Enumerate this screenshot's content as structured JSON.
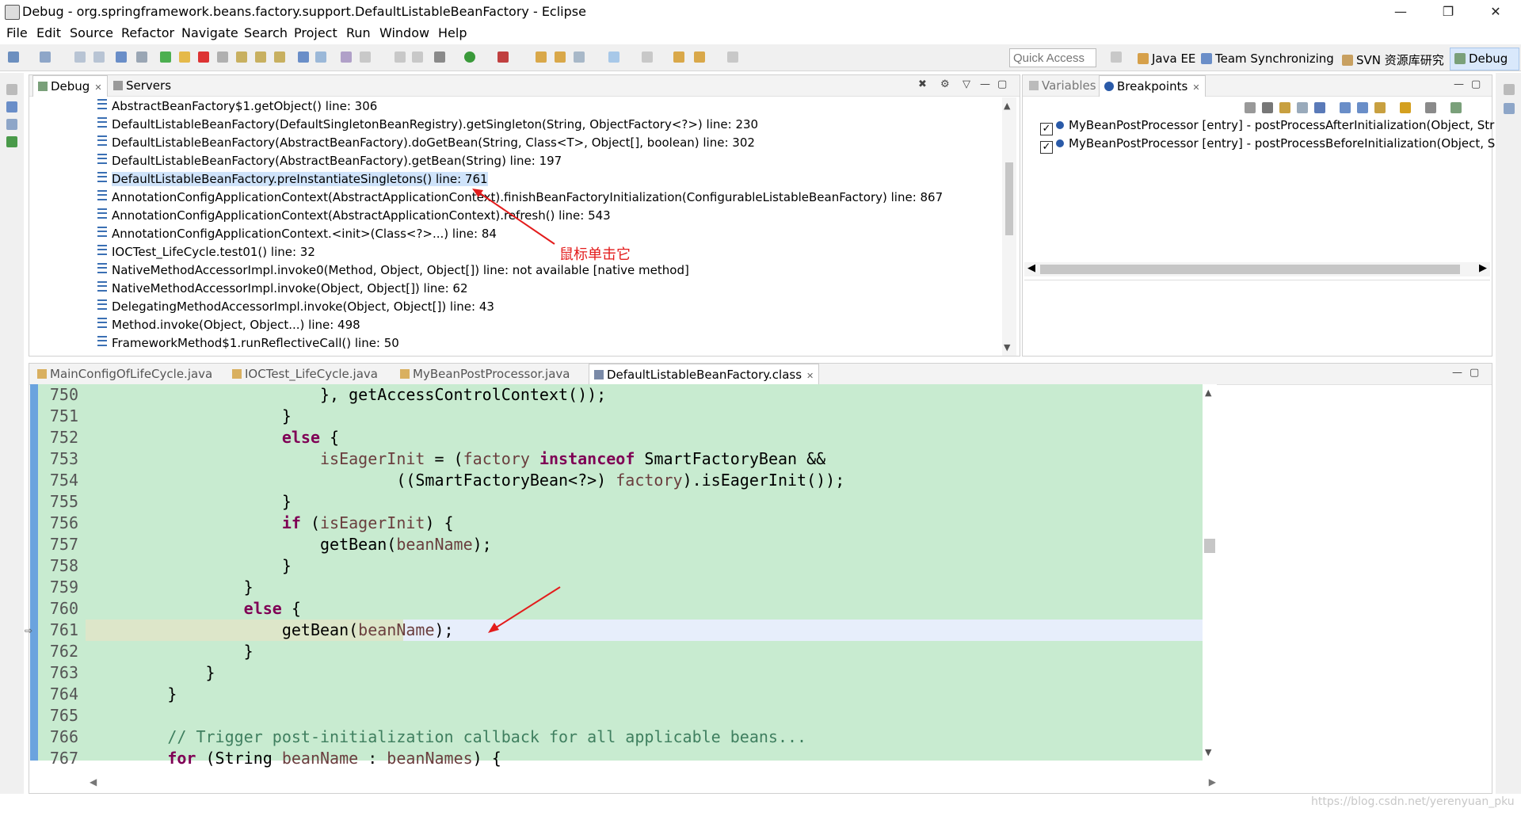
{
  "window": {
    "title": "Debug - org.springframework.beans.factory.support.DefaultListableBeanFactory - Eclipse",
    "controls": {
      "minimize": "—",
      "restore": "❐",
      "close": "✕"
    }
  },
  "menu": [
    "File",
    "Edit",
    "Source",
    "Refactor",
    "Navigate",
    "Search",
    "Project",
    "Run",
    "Window",
    "Help"
  ],
  "toolbar": {
    "quick_access_placeholder": "Quick Access",
    "perspectives": [
      "Java EE",
      "Team Synchronizing",
      "SVN 资源库研究",
      "Debug"
    ]
  },
  "debug_view": {
    "tabs": [
      "Debug",
      "Servers"
    ],
    "frames": [
      "AbstractBeanFactory$1.getObject() line: 306",
      "DefaultListableBeanFactory(DefaultSingletonBeanRegistry).getSingleton(String, ObjectFactory<?>) line: 230",
      "DefaultListableBeanFactory(AbstractBeanFactory).doGetBean(String, Class<T>, Object[], boolean) line: 302",
      "DefaultListableBeanFactory(AbstractBeanFactory).getBean(String) line: 197",
      "DefaultListableBeanFactory.preInstantiateSingletons() line: 761",
      "AnnotationConfigApplicationContext(AbstractApplicationContext).finishBeanFactoryInitialization(ConfigurableListableBeanFactory) line: 867",
      "AnnotationConfigApplicationContext(AbstractApplicationContext).refresh() line: 543",
      "AnnotationConfigApplicationContext.<init>(Class<?>...) line: 84",
      "IOCTest_LifeCycle.test01() line: 32",
      "NativeMethodAccessorImpl.invoke0(Method, Object, Object[]) line: not available [native method]",
      "NativeMethodAccessorImpl.invoke(Object, Object[]) line: 62",
      "DelegatingMethodAccessorImpl.invoke(Object, Object[]) line: 43",
      "Method.invoke(Object, Object...) line: 498",
      "FrameworkMethod$1.runReflectiveCall() line: 50"
    ],
    "annotation": "鼠标单击它"
  },
  "breakpoints_view": {
    "tabs": [
      "Variables",
      "Breakpoints"
    ],
    "items": [
      {
        "checked": "✓",
        "label": "MyBeanPostProcessor [entry] - postProcessAfterInitialization(Object, Str"
      },
      {
        "checked": "✓",
        "label": "MyBeanPostProcessor [entry] - postProcessBeforeInitialization(Object, S"
      }
    ]
  },
  "editor": {
    "tabs": [
      "MainConfigOfLifeCycle.java",
      "IOCTest_LifeCycle.java",
      "MyBeanPostProcessor.java",
      "DefaultListableBeanFactory.class"
    ],
    "lines": [
      {
        "num": "750",
        "code": "                        }, getAccessControlContext());"
      },
      {
        "num": "751",
        "code": "                    }"
      },
      {
        "num": "752",
        "code": "                    else {"
      },
      {
        "num": "753",
        "code": "                        isEagerInit = (factory instanceof SmartFactoryBean &&"
      },
      {
        "num": "754",
        "code": "                                ((SmartFactoryBean<?>) factory).isEagerInit());"
      },
      {
        "num": "755",
        "code": "                    }"
      },
      {
        "num": "756",
        "code": "                    if (isEagerInit) {"
      },
      {
        "num": "757",
        "code": "                        getBean(beanName);"
      },
      {
        "num": "758",
        "code": "                    }"
      },
      {
        "num": "759",
        "code": "                }"
      },
      {
        "num": "760",
        "code": "                else {"
      },
      {
        "num": "761",
        "code": "                    getBean(beanName);"
      },
      {
        "num": "762",
        "code": "                }"
      },
      {
        "num": "763",
        "code": "            }"
      },
      {
        "num": "764",
        "code": "        }"
      },
      {
        "num": "765",
        "code": ""
      },
      {
        "num": "766",
        "code": "        // Trigger post-initialization callback for all applicable beans..."
      },
      {
        "num": "767",
        "code": "        for (String beanName : beanNames) {"
      }
    ]
  },
  "watermark": "https://blog.csdn.net/yerenyuan_pku",
  "colors": {
    "selection": "#cfe3fa",
    "editor_bg": "#c8ebd0",
    "current_line": "#e7eefb",
    "annotation": "#e31c1c"
  }
}
